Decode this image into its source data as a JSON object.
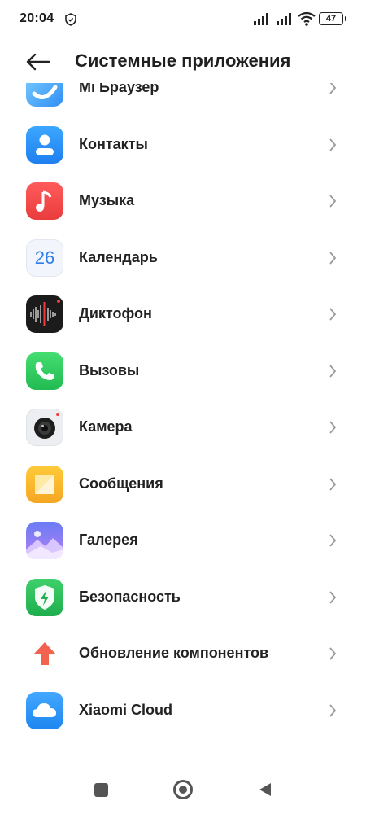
{
  "status": {
    "time": "20:04",
    "battery": "47"
  },
  "header": {
    "title": "Системные приложения"
  },
  "apps": [
    {
      "label": "Mi Браузер",
      "icon": "browser-icon"
    },
    {
      "label": "Контакты",
      "icon": "contacts-icon"
    },
    {
      "label": "Музыка",
      "icon": "music-icon"
    },
    {
      "label": "Календарь",
      "icon": "calendar-icon",
      "icon_text": "26"
    },
    {
      "label": "Диктофон",
      "icon": "recorder-icon"
    },
    {
      "label": "Вызовы",
      "icon": "phone-icon"
    },
    {
      "label": "Камера",
      "icon": "camera-icon"
    },
    {
      "label": "Сообщения",
      "icon": "messages-icon"
    },
    {
      "label": "Галерея",
      "icon": "gallery-icon"
    },
    {
      "label": "Безопасность",
      "icon": "security-icon"
    },
    {
      "label": "Обновление компонентов",
      "icon": "update-icon"
    },
    {
      "label": "Xiaomi Cloud",
      "icon": "cloud-icon"
    }
  ],
  "colors": {
    "accent_red": "#ef5350",
    "accent_blue": "#2f8ef5",
    "accent_green": "#2fc95e",
    "accent_yellow": "#f7b928"
  }
}
